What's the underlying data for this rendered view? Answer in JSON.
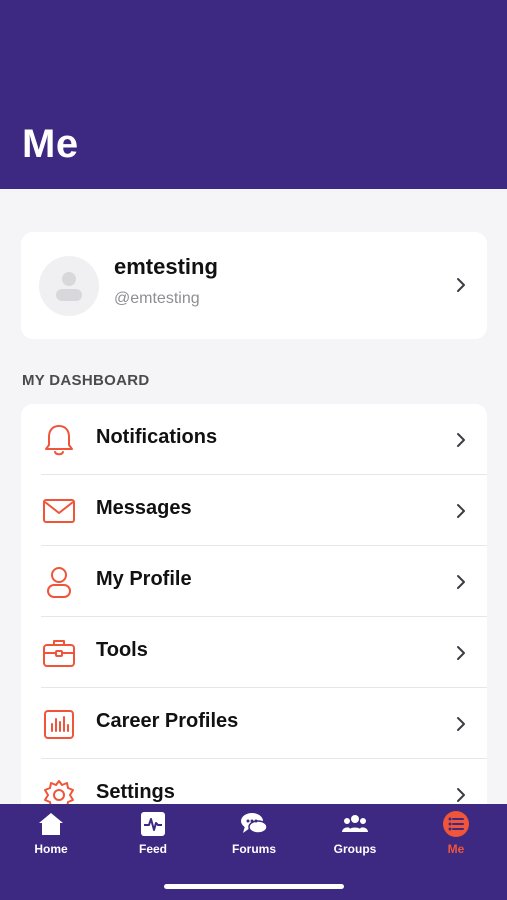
{
  "header": {
    "title": "Me"
  },
  "profile": {
    "name": "emtesting",
    "handle": "@emtesting"
  },
  "dashboard": {
    "section_label": "MY DASHBOARD",
    "items": [
      {
        "label": "Notifications",
        "icon": "bell-icon"
      },
      {
        "label": "Messages",
        "icon": "envelope-icon"
      },
      {
        "label": "My Profile",
        "icon": "person-icon"
      },
      {
        "label": "Tools",
        "icon": "toolbox-icon"
      },
      {
        "label": "Career Profiles",
        "icon": "bar-chart-icon"
      },
      {
        "label": "Settings",
        "icon": "gear-icon"
      }
    ]
  },
  "tabbar": {
    "tabs": [
      {
        "label": "Home",
        "icon": "home-icon"
      },
      {
        "label": "Feed",
        "icon": "pulse-icon"
      },
      {
        "label": "Forums",
        "icon": "chat-bubbles-icon"
      },
      {
        "label": "Groups",
        "icon": "group-icon"
      },
      {
        "label": "Me",
        "icon": "list-icon",
        "active": true
      }
    ]
  },
  "colors": {
    "brand": "#3d2882",
    "accent": "#f0553a",
    "background": "#f5f5f7"
  }
}
